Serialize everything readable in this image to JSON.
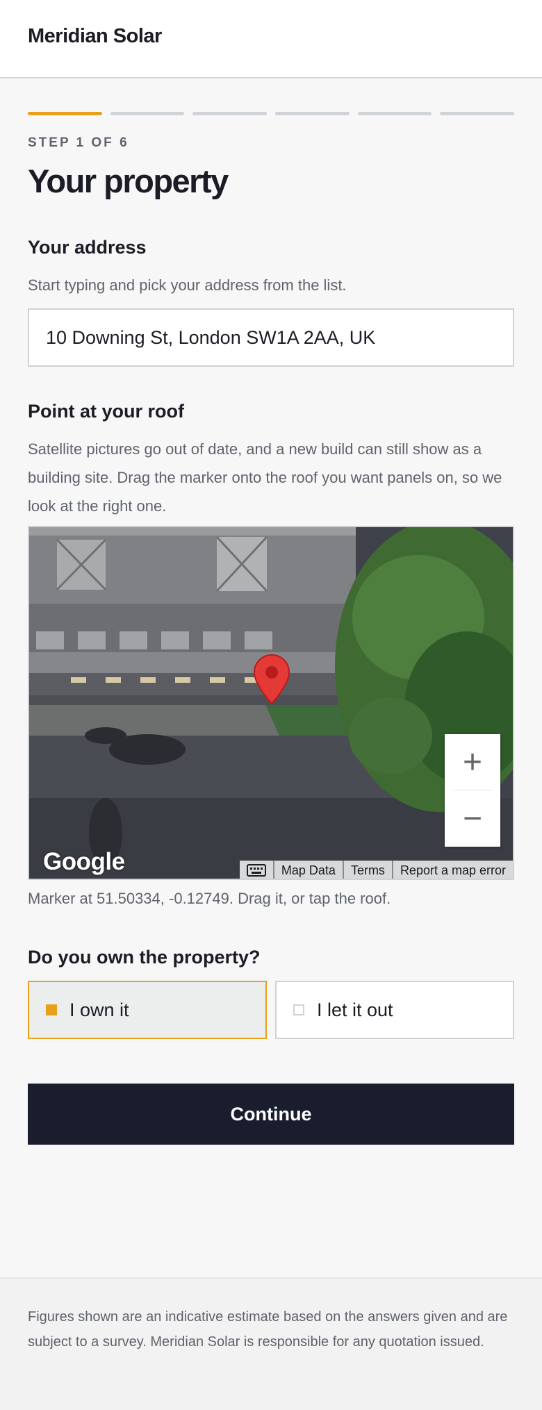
{
  "header": {
    "brand": "Meridian Solar"
  },
  "progress": {
    "current_step": 1,
    "total_steps": 6
  },
  "step_label": "STEP 1 OF 6",
  "page_title": "Your property",
  "address_section": {
    "heading": "Your address",
    "help": "Start typing and pick your address from the list.",
    "value": "10 Downing St, London SW1A 2AA, UK"
  },
  "roof_section": {
    "heading": "Point at your roof",
    "help": "Satellite pictures go out of date, and a new build can still show as a building site. Drag the marker onto the roof you want panels on, so we look at the right one.",
    "map": {
      "logo": "Google",
      "zoom_in": "+",
      "zoom_out": "−",
      "attribution": {
        "map_data": "Map Data",
        "terms": "Terms",
        "report": "Report a map error"
      },
      "marker_color": "#e53935",
      "icons": [
        "map-pin-icon",
        "keyboard-icon"
      ]
    },
    "caption": "Marker at 51.50334, -0.12749. Drag it, or tap the roof."
  },
  "ownership": {
    "question": "Do you own the property?",
    "options": [
      {
        "label": "I own it",
        "selected": true
      },
      {
        "label": "I let it out",
        "selected": false
      }
    ]
  },
  "continue_label": "Continue",
  "footer": {
    "disclaimer": "Figures shown are an indicative estimate based on the answers given and are subject to a survey. Meridian Solar is responsible for any quotation issued."
  },
  "colors": {
    "accent": "#e8a01c",
    "button": "#1a1d2e",
    "muted_text": "#5f636d"
  }
}
